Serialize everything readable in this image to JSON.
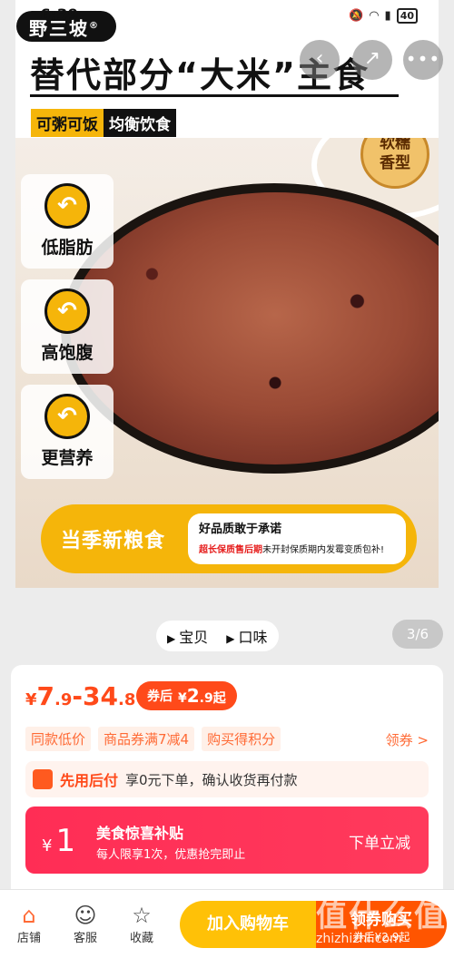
{
  "status": {
    "time": "6:39",
    "battery": "40"
  },
  "brand": {
    "name": "野三坡",
    "reg": "®"
  },
  "nav": {
    "back_icon": "back-icon",
    "share_icon": "share-icon",
    "more_icon": "more-icon"
  },
  "hero": {
    "headline": "替代部分“大米”主食",
    "tag1": "可粥可饭",
    "tag2": "均衡饮食",
    "seal": "软糯香型",
    "seal_line1": "软糯",
    "seal_line2": "香型",
    "features": [
      "低脂肪",
      "高饱腹",
      "更营养"
    ],
    "banner_title": "当季新粮食",
    "banner_promise": "好品质敢于承诺",
    "banner_red": "超长保质售后期",
    "banner_rest": "未开封保质期内发霉变质包补!"
  },
  "tabs": {
    "item1": "宝贝",
    "item2": "口味",
    "counter": "3/6"
  },
  "price": {
    "currency": "¥",
    "low_int": "7",
    "low_dec": ".9",
    "dash": "-",
    "high_int": "34",
    "high_dec": ".8",
    "coupon_label": "券后",
    "coupon_cur": "¥",
    "coupon_int": "2",
    "coupon_dec": ".9",
    "coupon_suffix": "起"
  },
  "promos": {
    "tags": [
      "同款低价",
      "商品券满7减4",
      "购买得积分"
    ],
    "get_coupon": "领券 >"
  },
  "pay_later": {
    "title": "先用后付",
    "desc": "享0元下单，确认收货再付款"
  },
  "subsidy": {
    "currency": "¥",
    "amount": "1",
    "title": "美食惊喜补贴",
    "desc": "每人限享1次，优惠抢完即止",
    "action": "下单立减"
  },
  "bottom": {
    "store": "店铺",
    "service": "客服",
    "favorite": "收藏",
    "cart": "加入购物车",
    "buy_line1": "领券购买",
    "buy_line2": "券后¥2.9起"
  },
  "watermark": {
    "logo": "值什么值",
    "site": "zhizhizhi.com"
  }
}
